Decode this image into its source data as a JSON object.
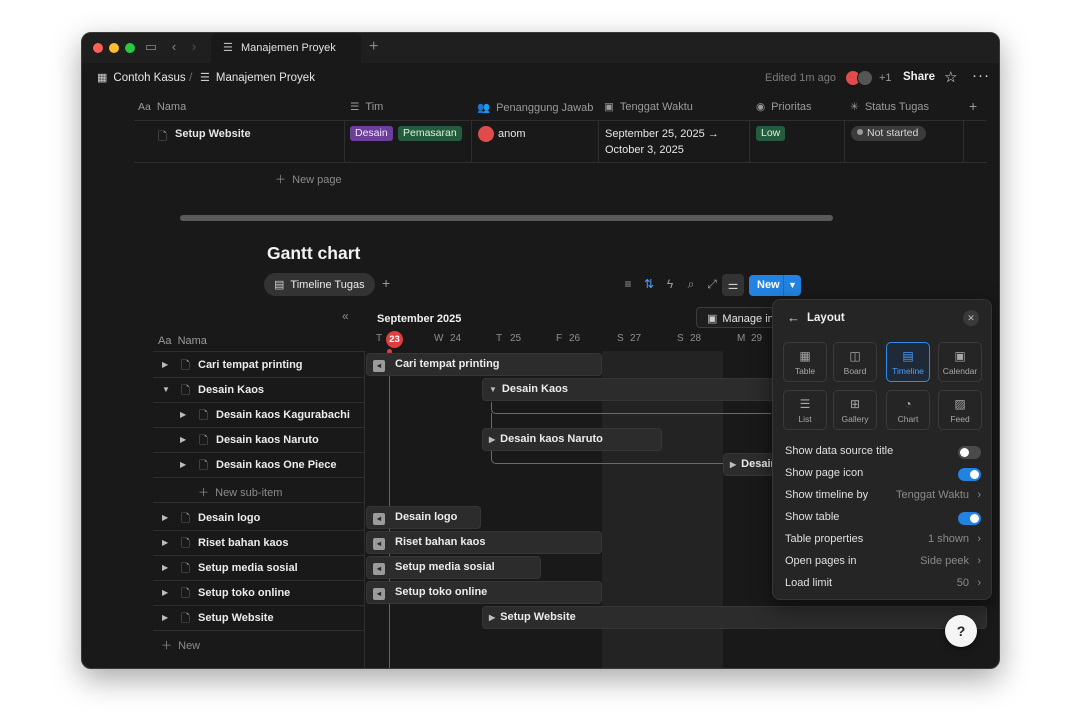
{
  "tab": {
    "title": "Manajemen Proyek"
  },
  "breadcrumb": {
    "workspace": "Contoh Kasus",
    "page": "Manajemen Proyek"
  },
  "topbar": {
    "edited": "Edited 1m ago",
    "extra_users": "+1",
    "share": "Share"
  },
  "table": {
    "columns": [
      "Nama",
      "Tim",
      "Penanggung Jawab",
      "Tenggat Waktu",
      "Prioritas",
      "Status Tugas"
    ],
    "row": {
      "name": "Setup Website",
      "tags": [
        "Desain",
        "Pemasaran"
      ],
      "assignee": "anom",
      "date_line1": "September 25, 2025 →",
      "date_line2": "October 3, 2025",
      "priority": "Low",
      "status": "Not started"
    },
    "new_page": "New page"
  },
  "gantt": {
    "title": "Gantt chart",
    "view_tab": "Timeline Tugas",
    "new_button": "New",
    "month": "September 2025",
    "manage": "Manage in",
    "name_header": "Nama",
    "days": [
      {
        "letter": "T",
        "num": "23"
      },
      {
        "letter": "W",
        "num": "24"
      },
      {
        "letter": "T",
        "num": "25"
      },
      {
        "letter": "F",
        "num": "26"
      },
      {
        "letter": "S",
        "num": "27"
      },
      {
        "letter": "S",
        "num": "28"
      },
      {
        "letter": "M",
        "num": "29"
      }
    ],
    "rows": [
      "Cari tempat printing",
      "Desain Kaos",
      "Desain kaos Kagurabachi",
      "Desain kaos Naruto",
      "Desain kaos One Piece",
      "New sub-item",
      "Desain logo",
      "Riset bahan kaos",
      "Setup media sosial",
      "Setup toko online",
      "Setup Website",
      "New"
    ],
    "bars": {
      "b1": "Cari tempat printing",
      "b2": "Desain Kaos",
      "b3": "Desain kaos Naruto",
      "b4": "Desain kaos One Piece",
      "b5": "Desain logo",
      "b6": "Riset bahan kaos",
      "b7": "Setup media sosial",
      "b8": "Setup toko online",
      "b9": "Setup Website"
    }
  },
  "layout_panel": {
    "title": "Layout",
    "options": [
      "Table",
      "Board",
      "Timeline",
      "Calendar",
      "List",
      "Gallery",
      "Chart",
      "Feed"
    ],
    "selected": "Timeline",
    "settings": {
      "data_source_title": "Show data source title",
      "page_icon": "Show page icon",
      "timeline_by": "Show timeline by",
      "timeline_by_value": "Tenggat Waktu",
      "show_table": "Show table",
      "table_properties": "Table properties",
      "table_properties_value": "1 shown",
      "open_pages": "Open pages in",
      "open_pages_value": "Side peek",
      "load_limit": "Load limit",
      "load_limit_value": "50"
    },
    "toggles": {
      "data_source_title": false,
      "page_icon": true,
      "show_table": true
    }
  },
  "colors": {
    "accent": "#2383e2",
    "today": "#e03e3e",
    "tag_purple": "#6c3f9a",
    "tag_green": "#245c3d"
  }
}
